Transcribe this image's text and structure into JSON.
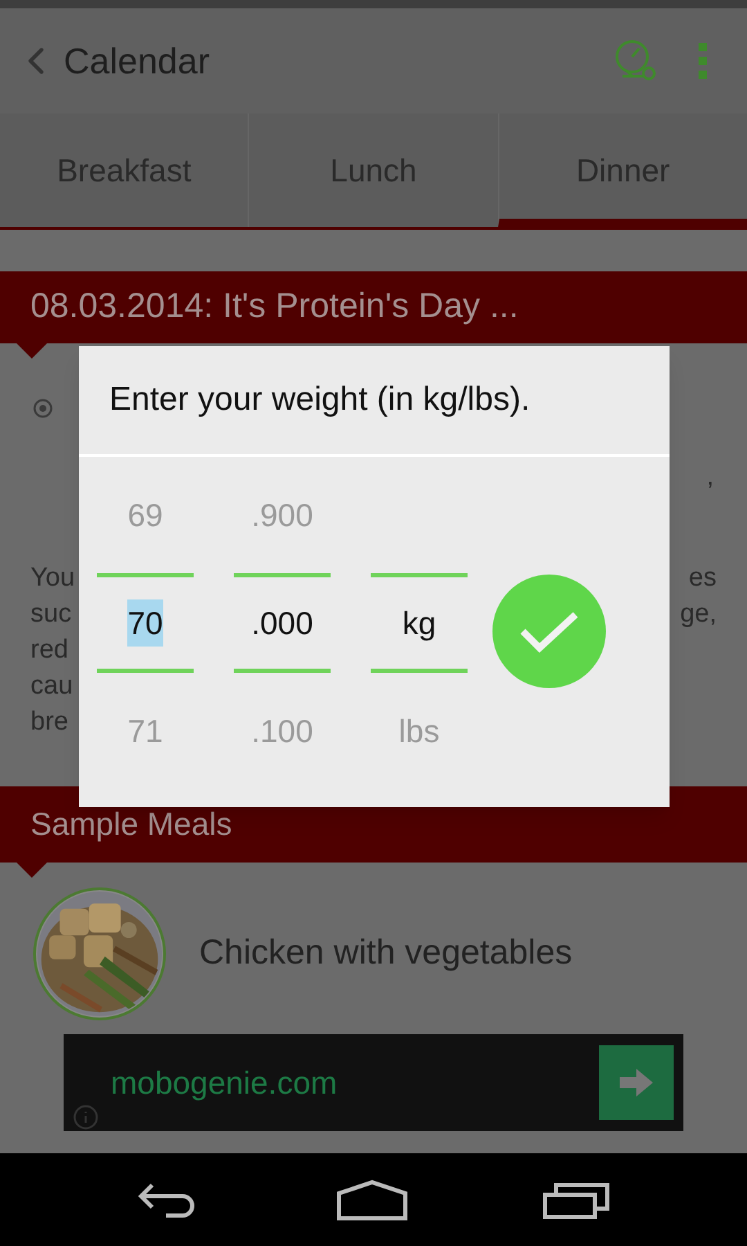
{
  "app_bar": {
    "title": "Calendar"
  },
  "tabs": [
    {
      "label": "Breakfast",
      "selected": false
    },
    {
      "label": "Lunch",
      "selected": false
    },
    {
      "label": "Dinner",
      "selected": true
    }
  ],
  "banner": {
    "title": "08.03.2014: It's Protein's Day ..."
  },
  "bullet": {
    "fragment": ","
  },
  "paragraph_rows": [
    {
      "left": "You",
      "right": "es"
    },
    {
      "left": "suc",
      "right": "ge,"
    },
    {
      "left": "red"
    },
    {
      "left": "cau"
    },
    {
      "left": "bre"
    }
  ],
  "section": {
    "title": "Sample Meals"
  },
  "meals": [
    {
      "name": "Chicken with vegetables",
      "kind": "picture"
    }
  ],
  "ad": {
    "text": "mobogenie.com"
  },
  "dialog": {
    "title": "Enter your weight (in kg/lbs).",
    "pickers": [
      {
        "above": "69",
        "value": "70",
        "below": "71",
        "text_selected": true
      },
      {
        "above": ".900",
        "value": ".000",
        "below": ".100",
        "text_selected": false
      },
      {
        "value": "kg",
        "below": "lbs",
        "text_selected": false
      }
    ]
  }
}
